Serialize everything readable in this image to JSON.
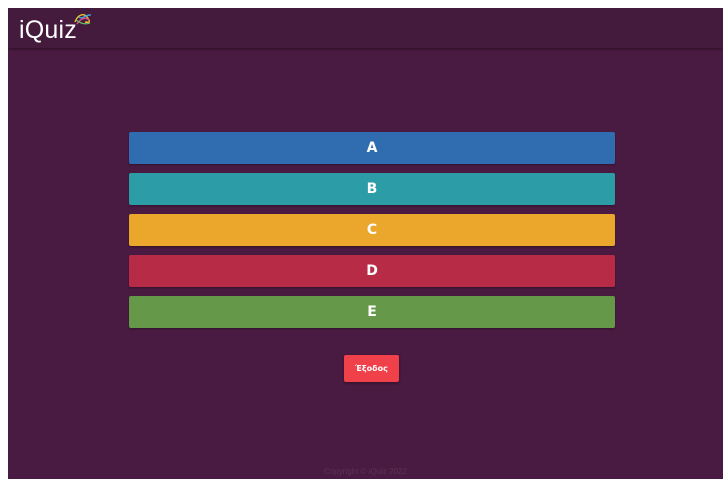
{
  "header": {
    "brand": "iQuiz",
    "logo_icon": "tangled-ribbon-logo-icon"
  },
  "answers": [
    {
      "label": "A",
      "color": "#2f6db0"
    },
    {
      "label": "B",
      "color": "#2c9ca6"
    },
    {
      "label": "C",
      "color": "#eba72c"
    },
    {
      "label": "D",
      "color": "#b82b47"
    },
    {
      "label": "E",
      "color": "#66984a"
    }
  ],
  "exit_button": {
    "label": "Έξοδος",
    "color": "#f0414b"
  },
  "footer": {
    "text": "Copyright © iQuiz 2022"
  },
  "colors": {
    "background": "#4a1b42",
    "topbar": "#441a3d"
  }
}
